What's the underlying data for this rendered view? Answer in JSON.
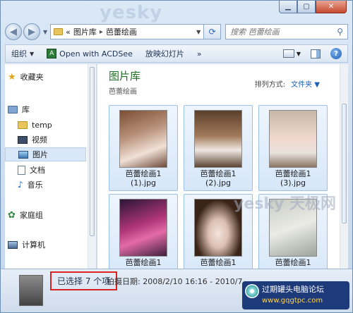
{
  "watermark_top": "yesky",
  "navigation": {
    "address_path": [
      "图片库",
      "芭蕾绘画"
    ],
    "address_prefix": "«",
    "search_placeholder": "搜索 芭蕾绘画"
  },
  "toolbar": {
    "organize_label": "组织",
    "acdsee_label": "Open with ACDSee",
    "slideshow_label": "放映幻灯片"
  },
  "sidebar": {
    "favorites_label": "收藏夹",
    "library_label": "库",
    "items": [
      {
        "label": "temp",
        "icon": "folder-icon"
      },
      {
        "label": "视频",
        "icon": "video-icon"
      },
      {
        "label": "图片",
        "icon": "picture-icon",
        "selected": true
      },
      {
        "label": "文档",
        "icon": "document-icon"
      },
      {
        "label": "音乐",
        "icon": "music-icon"
      }
    ],
    "homegroup_label": "家庭组",
    "computer_label": "计算机"
  },
  "content": {
    "title": "图片库",
    "subtitle": "芭蕾绘画",
    "arrange_label": "排列方式:",
    "arrange_value": "文件夹",
    "files": [
      {
        "line1": "芭蕾绘画1",
        "line2": "(1).jpg"
      },
      {
        "line1": "芭蕾绘画1",
        "line2": "(2).jpg"
      },
      {
        "line1": "芭蕾绘画1",
        "line2": "(3).jpg"
      },
      {
        "line1": "芭蕾绘画1",
        "line2": ""
      },
      {
        "line1": "芭蕾绘画1",
        "line2": ""
      },
      {
        "line1": "芭蕾绘画1",
        "line2": ""
      }
    ]
  },
  "overlay_watermark": "yesky 天极网",
  "status": {
    "selected_count": "已选择 7 个项",
    "taken_date": "拍摄日期: 2008/2/10 16:16 - 2010/7"
  },
  "badge": {
    "title": "过期罐头电脑论坛",
    "url": "www.gqgtpc.com"
  },
  "colors": {
    "library_title": "#1c6e22",
    "selection_highlight": "#d22"
  }
}
